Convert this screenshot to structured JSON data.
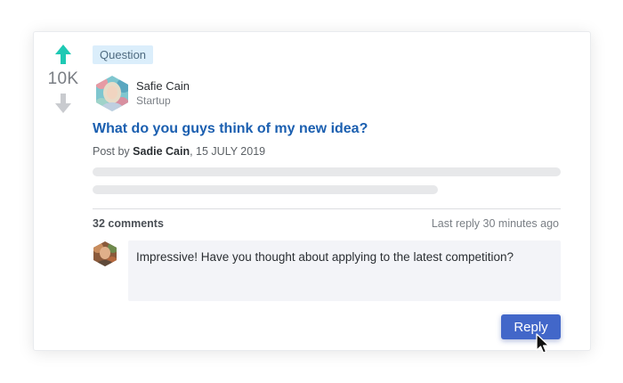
{
  "post": {
    "tag": "Question",
    "votes": "10K",
    "author": {
      "name": "Safie Cain",
      "role": "Startup"
    },
    "title": "What do you guys think of my new idea?",
    "byline": {
      "prefix": "Post by",
      "name": "Sadie Cain",
      "date": ", 15 JULY 2019"
    }
  },
  "comments": {
    "count_label": "32 comments",
    "last_reply": "Last reply 30 minutes ago",
    "reply_value": "Impressive! Have you thought about applying to the latest competition?",
    "reply_button": "Reply"
  },
  "colors": {
    "upvote": "#1ec9b4",
    "downvote": "#c9cbcf",
    "title": "#1b5fb0",
    "reply_button": "#4267c9"
  },
  "icons": {
    "upvote": "arrow-up-icon",
    "downvote": "arrow-down-icon",
    "cursor": "mouse-pointer-icon"
  }
}
